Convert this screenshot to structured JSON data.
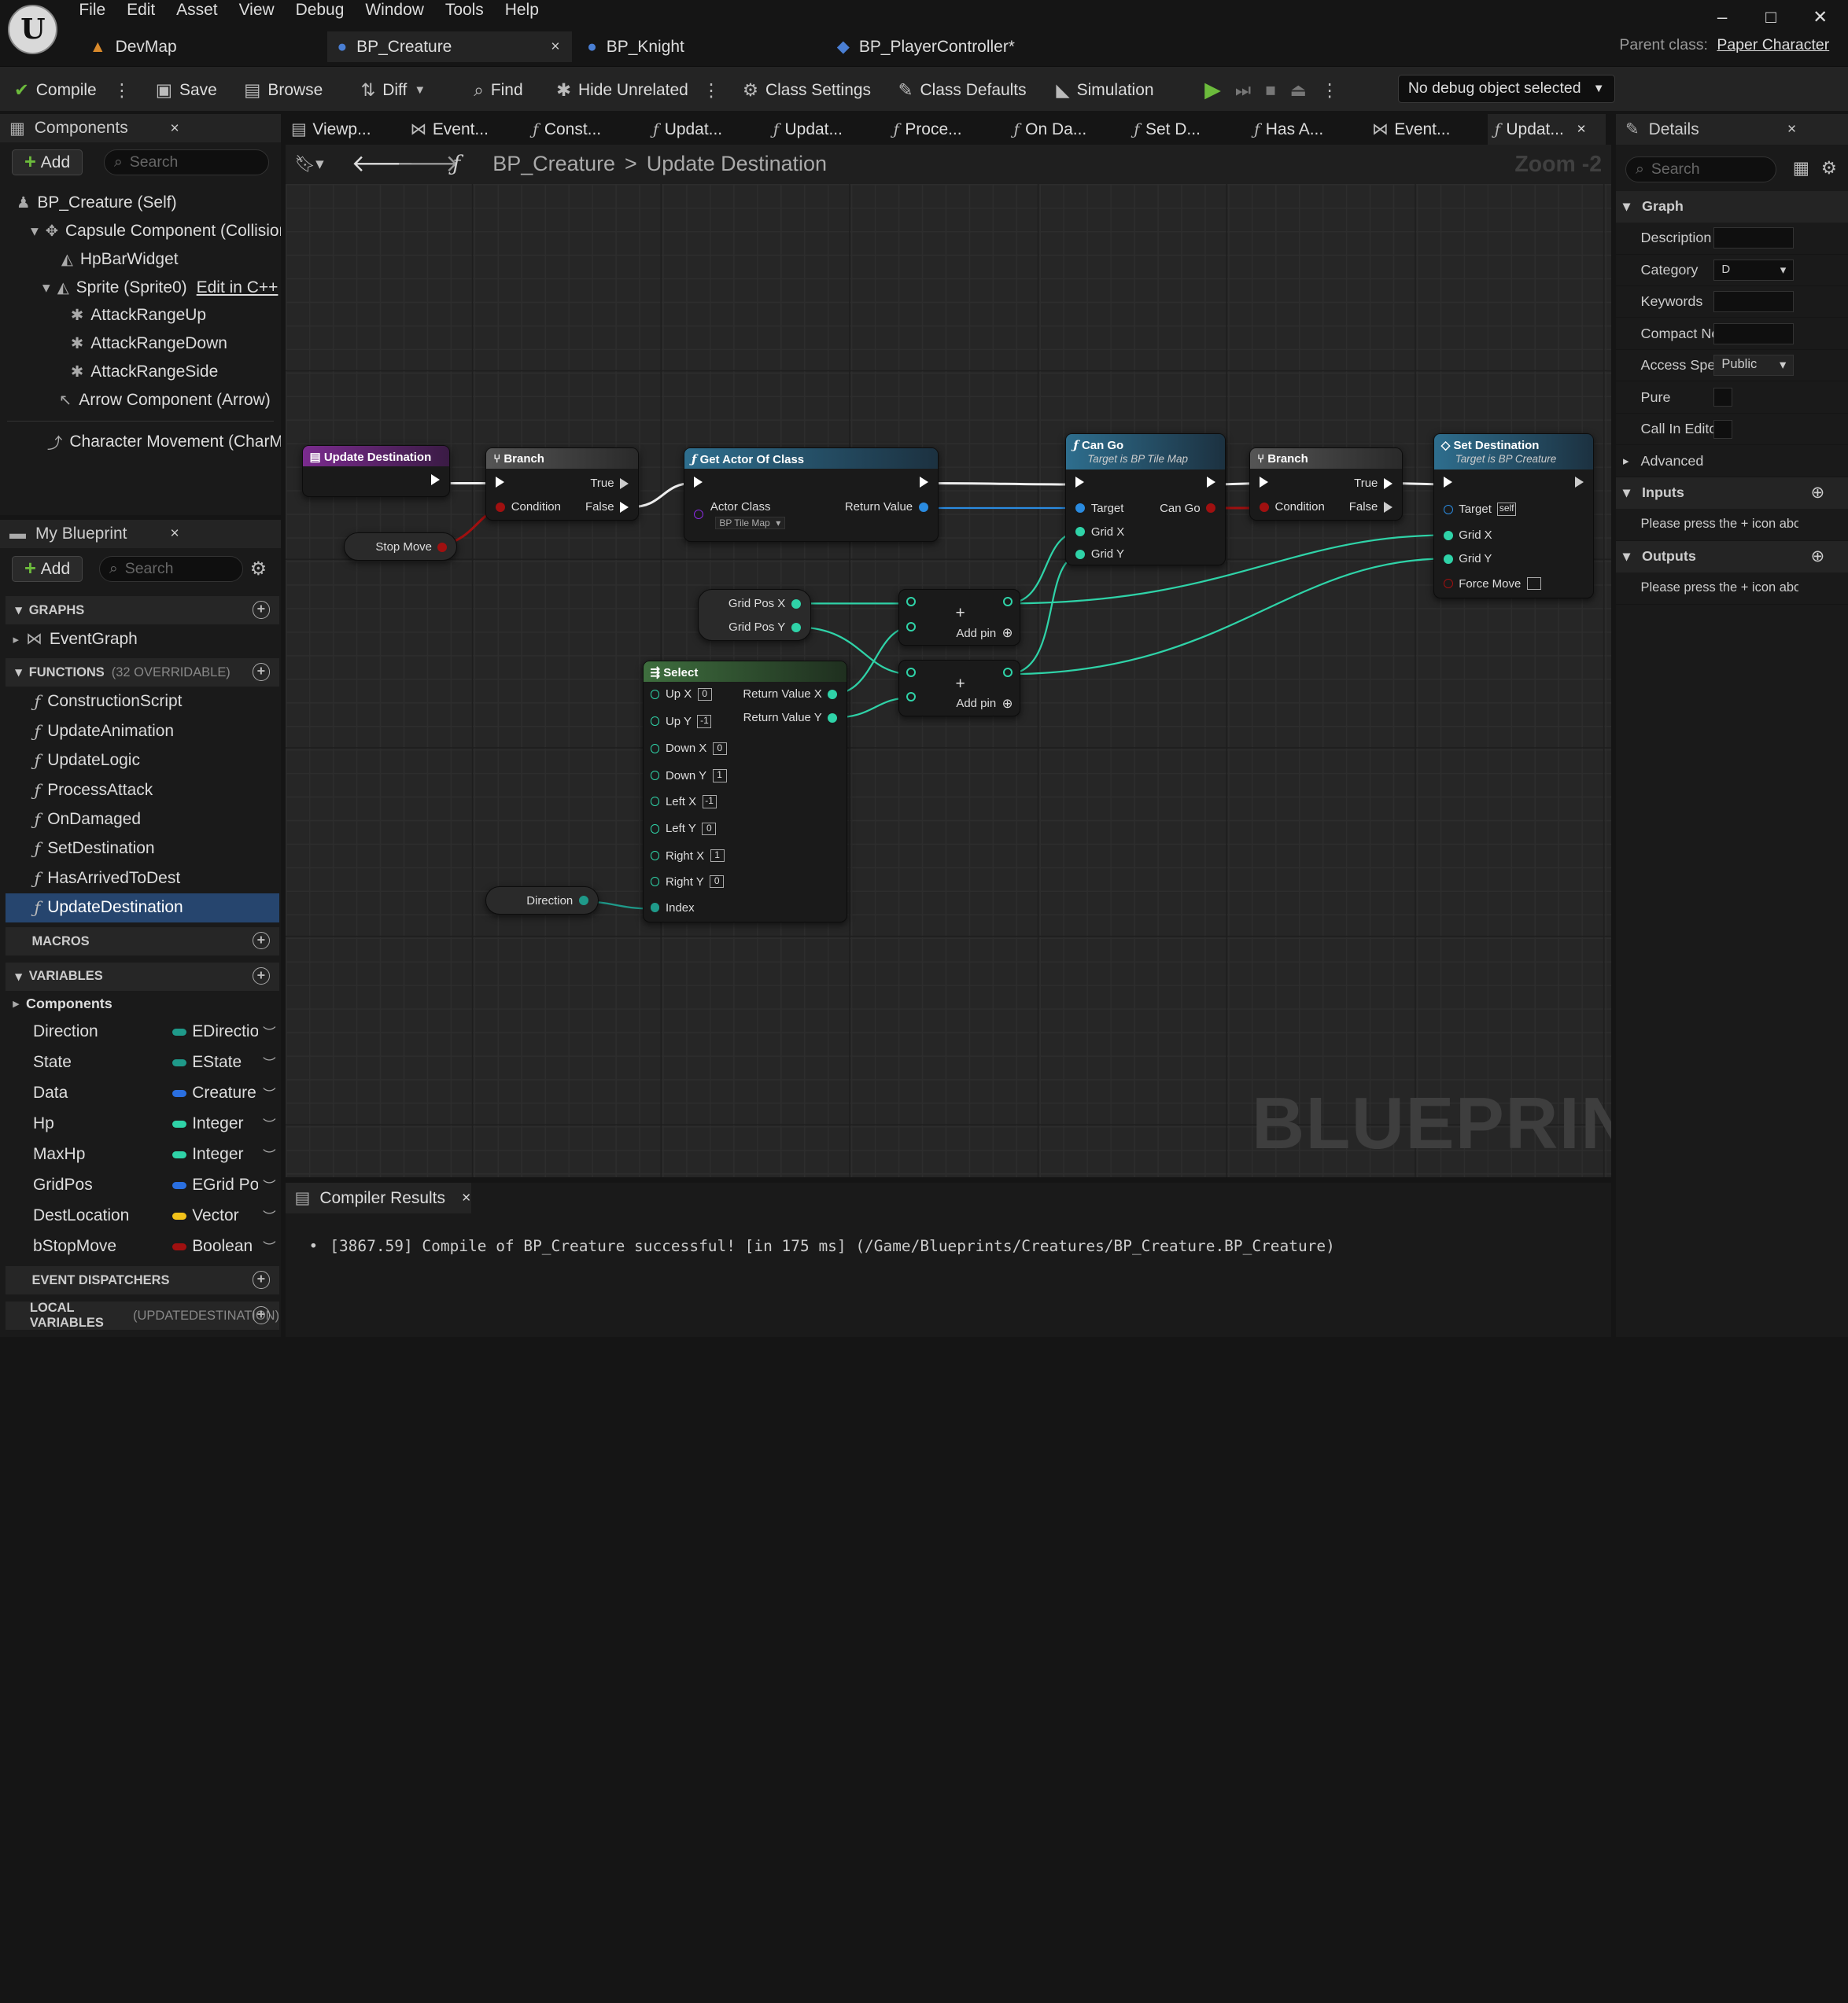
{
  "menu": [
    "File",
    "Edit",
    "Asset",
    "View",
    "Debug",
    "Window",
    "Tools",
    "Help"
  ],
  "window_controls": {
    "minimize": "–",
    "maximize": "□",
    "close": "✕"
  },
  "doc_tabs": [
    {
      "label": "DevMap",
      "icon": "map-icon"
    },
    {
      "label": "BP_Creature",
      "icon": "blueprint-actor-icon",
      "close": "×"
    },
    {
      "label": "BP_Knight",
      "icon": "blueprint-actor-icon"
    },
    {
      "label": "BP_PlayerController*",
      "icon": "controller-icon"
    }
  ],
  "parent_class": {
    "label": "Parent class:",
    "value": "Paper Character"
  },
  "toolbar": {
    "compile": "Compile",
    "save": "Save",
    "browse": "Browse",
    "diff": "Diff",
    "find": "Find",
    "hide_unrelated": "Hide Unrelated",
    "class_settings": "Class Settings",
    "class_defaults": "Class Defaults",
    "simulation": "Simulation",
    "debug_object": "No debug object selected"
  },
  "components_panel": {
    "title": "Components",
    "add": "Add",
    "search_placeholder": "Search",
    "items": [
      {
        "label": "BP_Creature (Self)"
      },
      {
        "label": "Capsule Component (CollisionCylinder)"
      },
      {
        "label": "HpBarWidget"
      },
      {
        "label": "Sprite (Sprite0)",
        "action": "Edit in C++"
      },
      {
        "label": "AttackRangeUp"
      },
      {
        "label": "AttackRangeDown"
      },
      {
        "label": "AttackRangeSide"
      },
      {
        "label": "Arrow Component (Arrow)"
      },
      {
        "label": "Character Movement (CharMoveComp)"
      }
    ]
  },
  "my_blueprint": {
    "title": "My Blueprint",
    "add": "Add",
    "search_placeholder": "Search",
    "graphs_header": "GRAPHS",
    "event_graph": "EventGraph",
    "functions_header": "FUNCTIONS",
    "functions_count": "(32 OVERRIDABLE)",
    "functions": [
      "ConstructionScript",
      "UpdateAnimation",
      "UpdateLogic",
      "ProcessAttack",
      "OnDamaged",
      "SetDestination",
      "HasArrivedToDest",
      "UpdateDestination"
    ],
    "macros_header": "MACROS",
    "variables_header": "VARIABLES",
    "components_group": "Components",
    "variables": [
      {
        "name": "Direction",
        "type": "EDirection",
        "color": "#1f9a8a"
      },
      {
        "name": "State",
        "type": "EState",
        "color": "#1f9a8a"
      },
      {
        "name": "Data",
        "type": "Creature",
        "color": "#2a6fe0"
      },
      {
        "name": "Hp",
        "type": "Integer",
        "color": "#2fd3a8"
      },
      {
        "name": "MaxHp",
        "type": "Integer",
        "color": "#2fd3a8"
      },
      {
        "name": "GridPos",
        "type": "EGrid Pos",
        "color": "#2a6fe0"
      },
      {
        "name": "DestLocation",
        "type": "Vector",
        "color": "#f2c21a"
      },
      {
        "name": "bStopMove",
        "type": "Boolean",
        "color": "#a01010"
      }
    ],
    "event_dispatchers_header": "EVENT DISPATCHERS",
    "local_variables_header": "LOCAL VARIABLES",
    "local_variables_scope": "(UPDATEDESTINATION)"
  },
  "graph_tabs": [
    "Viewp...",
    "Event...",
    "Const...",
    "Updat...",
    "Updat...",
    "Proce...",
    "On Da...",
    "Set D...",
    "Has A...",
    "Event...",
    "Updat..."
  ],
  "breadcrumb": {
    "root": "BP_Creature",
    "separator": ">",
    "current": "Update Destination",
    "zoom": "Zoom -2"
  },
  "watermark": "BLUEPRINT",
  "nodes": {
    "entry": {
      "title": "Update Destination"
    },
    "branch1": {
      "title": "Branch",
      "true": "True",
      "false": "False",
      "condition": "Condition"
    },
    "stop_move": {
      "label": "Stop Move"
    },
    "get_actor": {
      "title": "Get Actor Of Class",
      "actor_class": "Actor Class",
      "class_value": "BP Tile Map",
      "return": "Return Value"
    },
    "can_go": {
      "title": "Can Go",
      "subtitle": "Target is BP Tile Map",
      "target": "Target",
      "grid_x": "Grid X",
      "grid_y": "Grid Y",
      "out": "Can Go"
    },
    "branch2": {
      "title": "Branch",
      "true": "True",
      "false": "False",
      "condition": "Condition"
    },
    "set_dest": {
      "title": "Set Destination",
      "subtitle": "Target is BP Creature",
      "target": "Target",
      "self": "self",
      "grid_x": "Grid X",
      "grid_y": "Grid Y",
      "force": "Force Move"
    },
    "grid_pos": {
      "x": "Grid Pos X",
      "y": "Grid Pos Y"
    },
    "add_pin": "Add pin",
    "select": {
      "title": "Select",
      "pins": [
        {
          "label": "Up X",
          "value": "0"
        },
        {
          "label": "Up Y",
          "value": "-1"
        },
        {
          "label": "Down X",
          "value": "0"
        },
        {
          "label": "Down Y",
          "value": "1"
        },
        {
          "label": "Left X",
          "value": "-1"
        },
        {
          "label": "Left Y",
          "value": "0"
        },
        {
          "label": "Right X",
          "value": "1"
        },
        {
          "label": "Right Y",
          "value": "0"
        }
      ],
      "index": "Index",
      "ret_x": "Return Value X",
      "ret_y": "Return Value Y"
    },
    "direction": {
      "label": "Direction"
    }
  },
  "compiler": {
    "title": "Compiler Results",
    "message": "[3867.59] Compile of BP_Creature successful! [in 175 ms] (/Game/Blueprints/Creatures/BP_Creature.BP_Creature)"
  },
  "details": {
    "title": "Details",
    "search_placeholder": "Search",
    "graph_section": "Graph",
    "rows": [
      {
        "label": "Description"
      },
      {
        "label": "Category",
        "value": "D"
      },
      {
        "label": "Keywords"
      },
      {
        "label": "Compact Node Title"
      },
      {
        "label": "Access Specifier",
        "value": "Public"
      },
      {
        "label": "Pure"
      },
      {
        "label": "Call In Editor"
      }
    ],
    "advanced": "Advanced",
    "inputs": "Inputs",
    "inputs_hint": "Please press the + icon above to add parameters",
    "outputs": "Outputs",
    "outputs_hint": "Please press the + icon above to add parameters"
  }
}
